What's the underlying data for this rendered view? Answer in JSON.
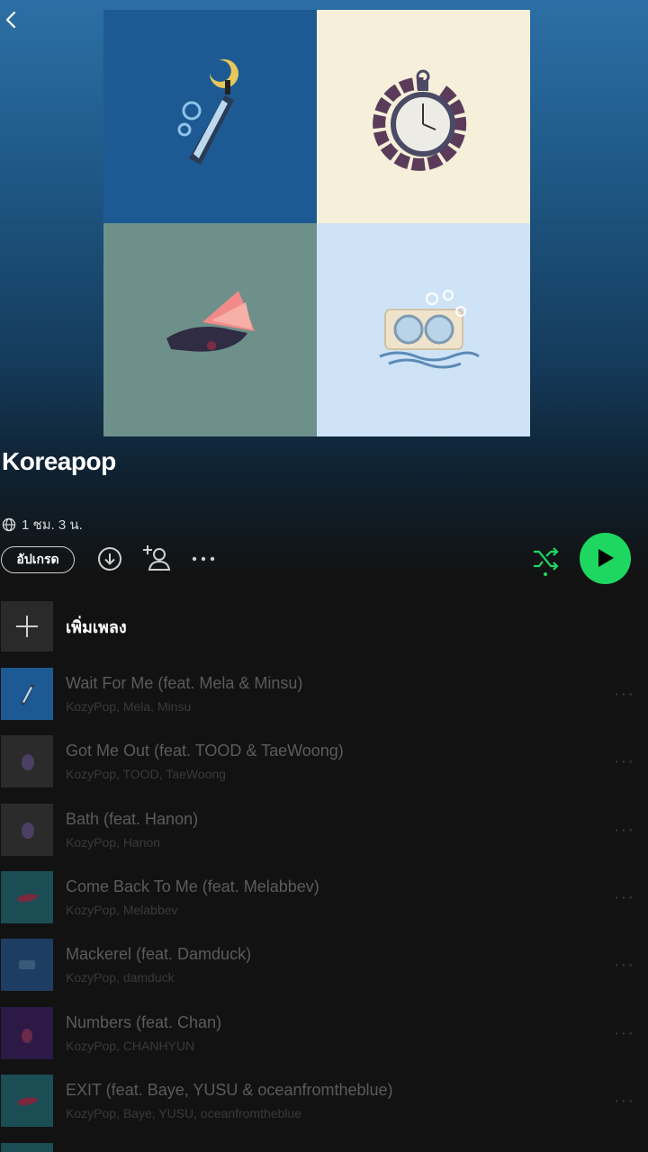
{
  "playlist": {
    "title": "Koreapop",
    "duration": "1 ชม. 3 น.",
    "upgrade_label": "อัปเกรด",
    "add_song_label": "เพิ่มเพลง"
  },
  "icons": {
    "back": "chevron-left-icon",
    "globe": "globe-icon",
    "download": "download-icon",
    "add_user": "add-user-icon",
    "more": "more-icon",
    "shuffle": "shuffle-icon",
    "play": "play-icon",
    "plus": "plus-icon"
  },
  "colors": {
    "accent": "#1ed760",
    "background": "#121212"
  },
  "tracks": [
    {
      "title": "Wait For Me (feat. Mela & Minsu)",
      "artists": "KozyPop, Mela, Minsu",
      "more": "···"
    },
    {
      "title": "Got Me Out (feat. TOOD & TaeWoong)",
      "artists": "KozyPop, TOOD, TaeWoong",
      "more": "···"
    },
    {
      "title": "Bath (feat. Hanon)",
      "artists": "KozyPop, Hanon",
      "more": "···"
    },
    {
      "title": "Come Back To Me (feat. Melabbev)",
      "artists": "KozyPop, Melabbev",
      "more": "···"
    },
    {
      "title": "Mackerel (feat. Damduck)",
      "artists": "KozyPop, damduck",
      "more": "···"
    },
    {
      "title": "Numbers (feat. Chan)",
      "artists": "KozyPop, CHANHYUN",
      "more": "···"
    },
    {
      "title": "EXIT (feat. Baye, YUSU & oceanfromtheblue)",
      "artists": "KozyPop, Baye, YUSU, oceanfromtheblue",
      "more": "···"
    }
  ]
}
